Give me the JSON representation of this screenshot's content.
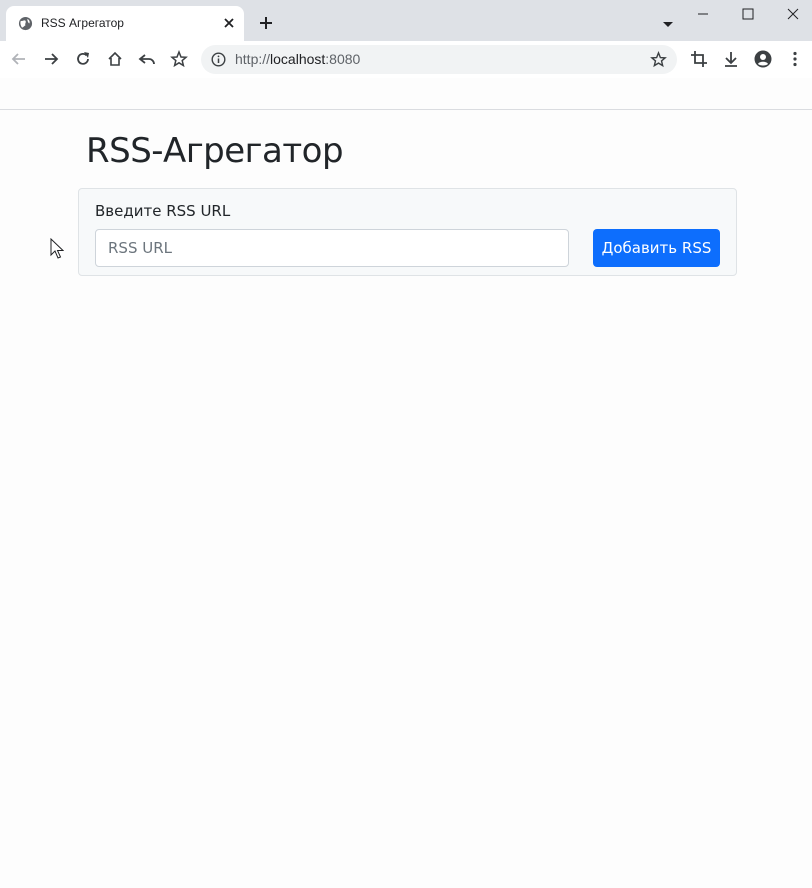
{
  "browser": {
    "tab_title": "RSS Агрегатор",
    "url_scheme": "http://",
    "url_host": "localhost",
    "url_port": ":8080"
  },
  "page": {
    "title": "RSS-Агрегатор",
    "form": {
      "label": "Введите RSS URL",
      "input_placeholder": "RSS URL",
      "input_value": "",
      "button_label": "Добавить RSS"
    }
  },
  "colors": {
    "button_bg": "#0d6efd",
    "card_bg": "#f7f9fa",
    "tabstrip_bg": "#dee1e6"
  },
  "icons": [
    "globe-icon",
    "close-icon",
    "plus-icon",
    "chevron-down-icon",
    "minimize-icon",
    "maximize-icon",
    "window-close-icon",
    "back-arrow-icon",
    "forward-arrow-icon",
    "reload-icon",
    "home-icon",
    "undo-icon",
    "star-icon",
    "info-icon",
    "crop-icon",
    "download-icon",
    "account-icon",
    "more-vert-icon",
    "cursor-icon"
  ]
}
